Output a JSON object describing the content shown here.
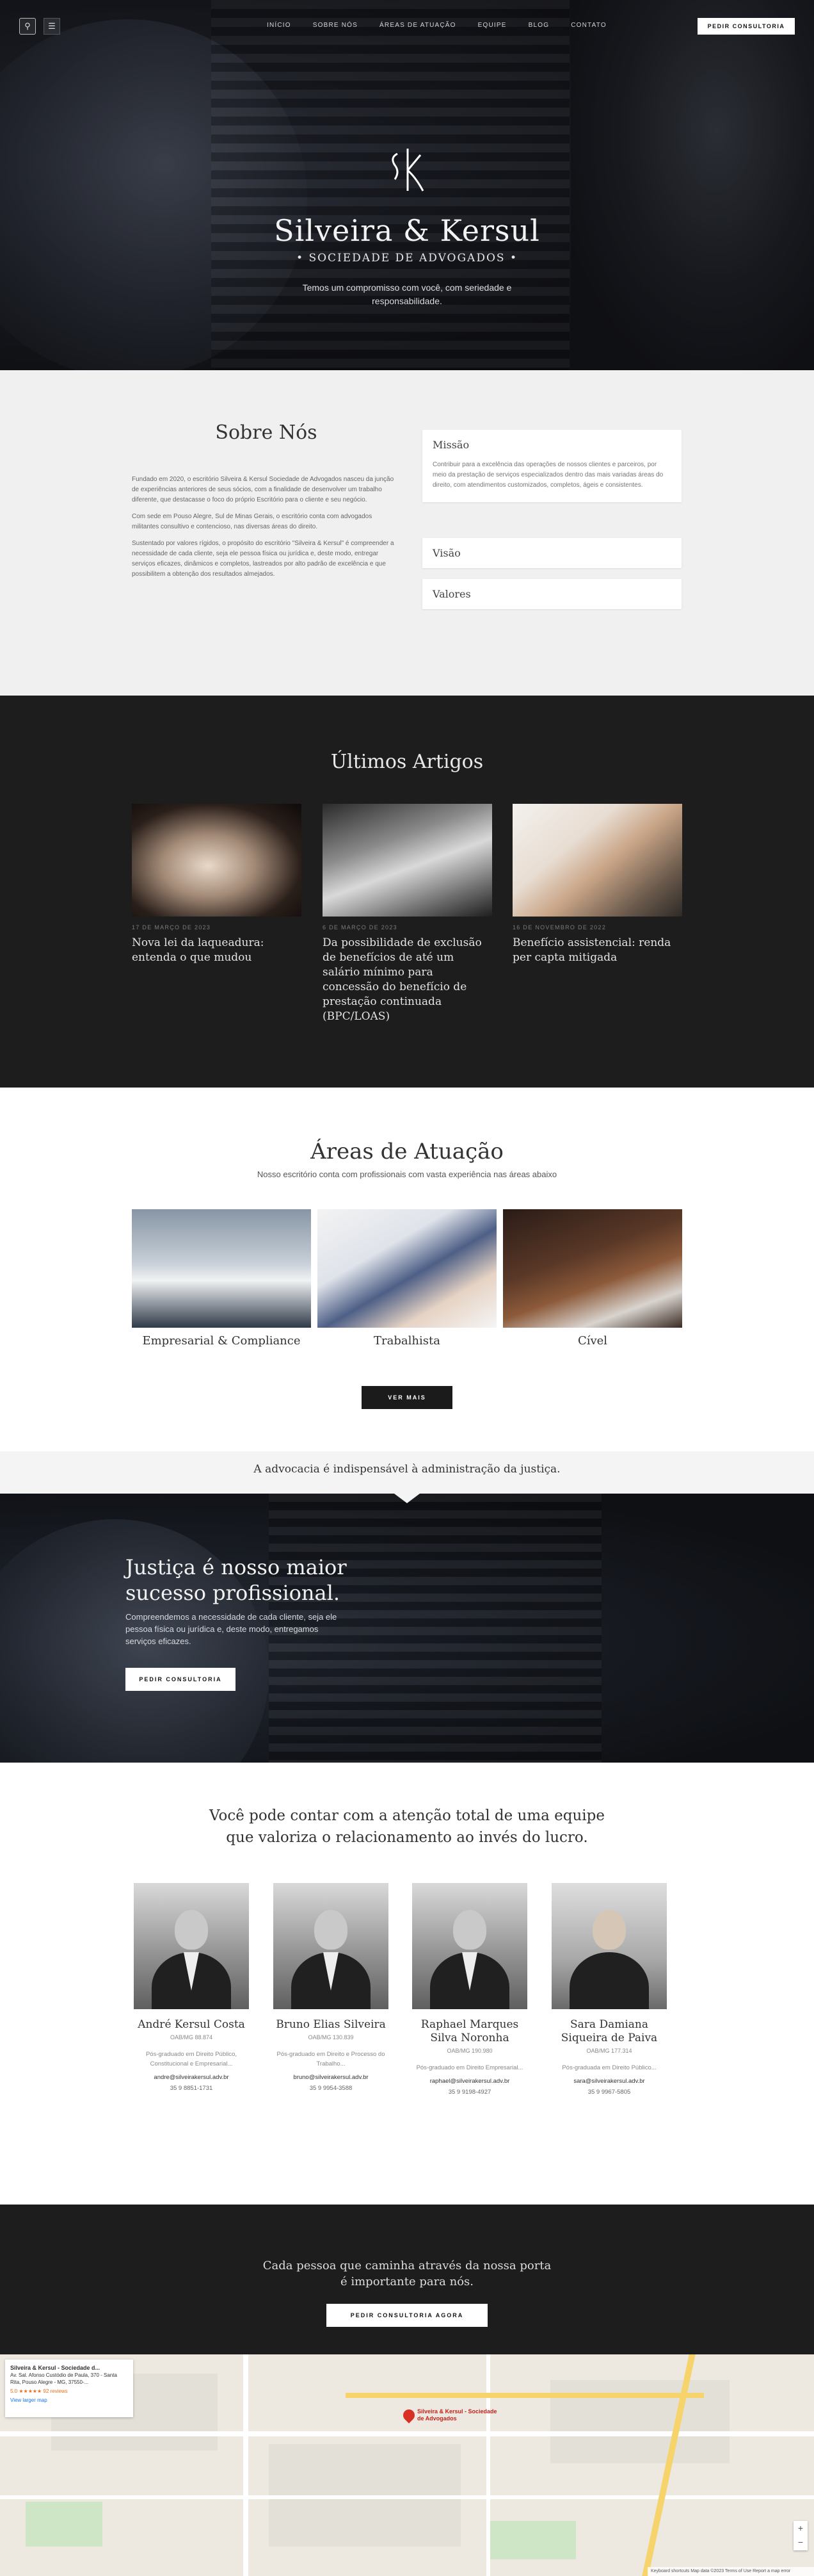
{
  "header": {
    "nav": [
      "INÍCIO",
      "SOBRE NÓS",
      "ÁREAS DE ATUAÇÃO",
      "EQUIPE",
      "BLOG",
      "CONTATO"
    ],
    "cta": "PEDIR CONSULTORIA"
  },
  "hero": {
    "brand": "Silveira & Kersul",
    "subtitle": "• SOCIEDADE DE ADVOGADOS •",
    "tagline_1": "Temos um compromisso com você, com seriedade e",
    "tagline_2": "responsabilidade."
  },
  "sobre": {
    "title": "Sobre Nós",
    "p1": "Fundado em 2020, o escritório Silveira & Kersul Sociedade de Advogados nasceu da junção de experiências anteriores de seus sócios, com a finalidade de desenvolver um trabalho diferente, que destacasse o foco do próprio Escritório para o cliente e seu negócio.",
    "p2": "Com sede em Pouso Alegre, Sul de Minas Gerais, o escritório conta com advogados militantes consultivo e contencioso, nas diversas áreas do direito.",
    "p3": "Sustentado por valores rígidos, o propósito do escritório \"Silveira & Kersul\" é compreender a necessidade de cada cliente, seja ele pessoa física ou jurídica e, deste modo, entregar serviços eficazes, dinâmicos e completos, lastreados por alto padrão de excelência e que possibilitem a obtenção dos resultados almejados.",
    "missao_title": "Missão",
    "missao_text": "Contribuir para a excelência das operações de nossos clientes e parceiros, por meio da prestação de serviços especializados dentro das mais variadas áreas do direito, com atendimentos customizados, completos, ágeis e consistentes.",
    "visao_title": "Visão",
    "valores_title": "Valores"
  },
  "articles": {
    "title": "Últimos Artigos",
    "items": [
      {
        "date": "17 DE MARÇO DE 2023",
        "title": "Nova lei da laqueadura: entenda o que mudou"
      },
      {
        "date": "6 DE MARÇO DE 2023",
        "title": "Da possibilidade de exclusão de benefícios de até um salário mínimo para concessão do benefício de prestação continuada (BPC/LOAS)"
      },
      {
        "date": "16 DE NOVEMBRO DE 2022",
        "title": "Benefício assistencial: renda per capta mitigada"
      }
    ]
  },
  "areas": {
    "title": "Áreas de Atuação",
    "subtitle": "Nosso escritório conta com profissionais com vasta experiência nas áreas abaixo",
    "items": [
      "Empresarial & Compliance",
      "Trabalhista",
      "Cível"
    ],
    "button": "VER MAIS"
  },
  "quote": "A advocacia é indispensável à administração da justiça.",
  "justice": {
    "title_1": "Justiça é nosso maior",
    "title_2": "sucesso profissional.",
    "text": "Compreendemos a necessidade de cada cliente, seja ele pessoa física ou jurídica e, deste modo, entregamos serviços eficazes.",
    "button": "PEDIR CONSULTORIA"
  },
  "team": {
    "title_1": "Você pode contar com a atenção total de uma equipe",
    "title_2": "que valoriza o relacionamento ao invés do lucro.",
    "members": [
      {
        "name": "André Kersul Costa",
        "oab": "OAB/MG 88.874",
        "spec": "Pós-graduado em Direito Público, Constitucional e Empresarial...",
        "email": "andre@silveirakersul.adv.br",
        "phone": "35 9 8851-1731"
      },
      {
        "name": "Bruno Elias Silveira",
        "oab": "OAB/MG 130.839",
        "spec": "Pós-graduado em Direito e Processo do Trabalho...",
        "email": "bruno@silveirakersul.adv.br",
        "phone": "35 9 9954-3588"
      },
      {
        "name": "Raphael Marques Silva Noronha",
        "oab": "OAB/MG 190.980",
        "spec": "Pós-graduado em Direito Empresarial...",
        "email": "raphael@silveirakersul.adv.br",
        "phone": "35 9 9198-4927"
      },
      {
        "name": "Sara Damiana Siqueira de Paiva",
        "oab": "OAB/MG 177.314",
        "spec": "Pós-graduada em Direito Público...",
        "email": "sara@silveirakersul.adv.br",
        "phone": "35 9 9967-5805"
      }
    ]
  },
  "cta_band": {
    "text_1": "Cada pessoa que caminha através da nossa porta",
    "text_2": "é importante para nós.",
    "button": "PEDIR CONSULTORIA AGORA"
  },
  "map": {
    "card_title": "Silveira & Kersul - Sociedade d...",
    "card_address": "Av. Sal. Afonso Custódio de Paula, 370 - Santa Rita, Pouso Alegre - MG, 37550-...",
    "card_rating": "5.0 ★★★★★ 92 reviews",
    "card_link": "View larger map",
    "pin_label": "Silveira & Kersul - Sociedade de Advogados",
    "footer": "Keyboard shortcuts   Map data ©2023   Terms of Use   Report a map error"
  }
}
